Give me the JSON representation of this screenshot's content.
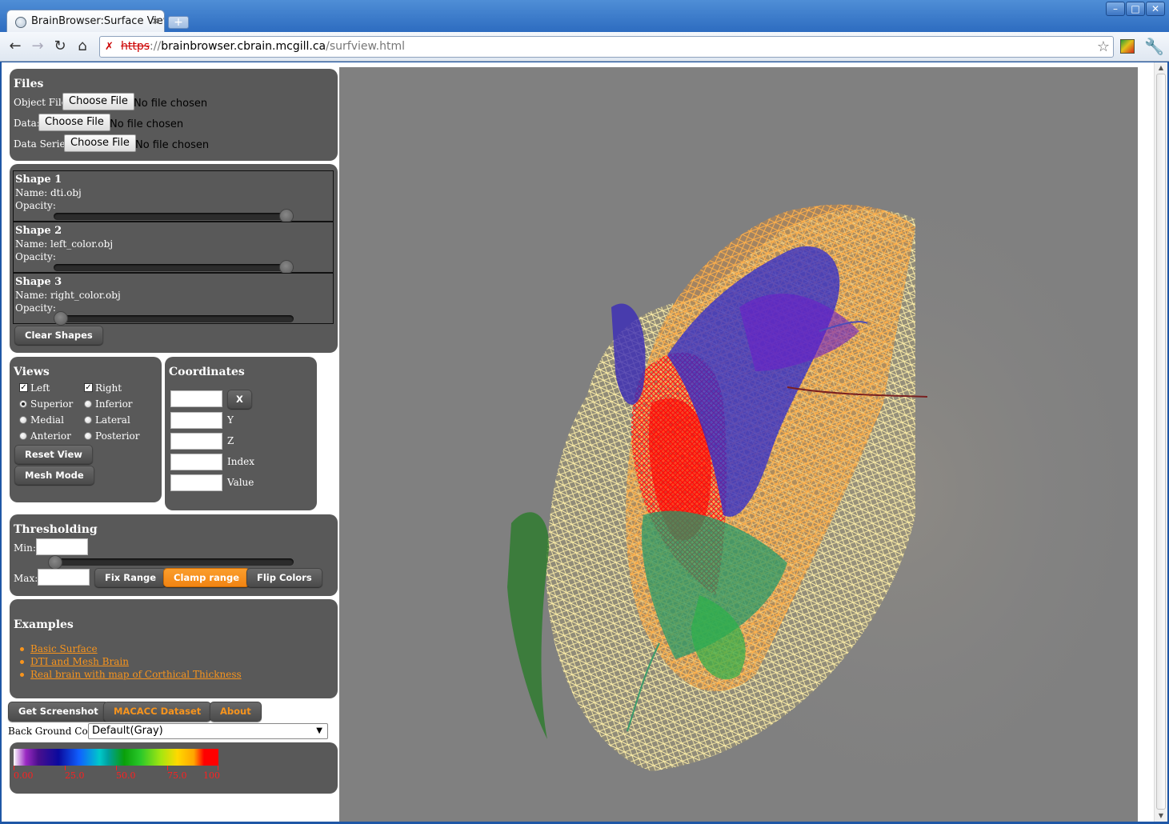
{
  "browser": {
    "tab_title": "BrainBrowser:Surface View",
    "tab_close": "×",
    "new_tab": "+",
    "url_scheme": "https",
    "url_sep": "://",
    "url_host": "brainbrowser.cbrain.mcgill.ca",
    "url_path": "/surfview.html",
    "star": "☆",
    "back": "←",
    "forward": "→",
    "reload": "↻",
    "home": "⌂",
    "wrench": "🔧",
    "win_min": "–",
    "win_max": "□",
    "win_close": "✕",
    "insecure_icon": "✗"
  },
  "files": {
    "heading": "Files",
    "choose_label": "Choose File",
    "no_file": "No file chosen",
    "rows": [
      {
        "label": "Object File:"
      },
      {
        "label": "Data:"
      },
      {
        "label": "Data Series:"
      }
    ]
  },
  "shapes": {
    "items": [
      {
        "title": "Shape 1",
        "name": "Name: dti.obj",
        "opacity_label": "Opacity:",
        "opacity": 1.0
      },
      {
        "title": "Shape 2",
        "name": "Name: left_color.obj",
        "opacity_label": "Opacity:",
        "opacity": 1.0
      },
      {
        "title": "Shape 3",
        "name": "Name: right_color.obj",
        "opacity_label": "Opacity:",
        "opacity": 0.0
      }
    ],
    "clear_label": "Clear Shapes"
  },
  "views": {
    "heading": "Views",
    "left": "Left",
    "right": "Right",
    "left_checked": true,
    "right_checked": true,
    "check_mark": "✓",
    "options": [
      "Superior",
      "Inferior",
      "Medial",
      "Lateral",
      "Anterior",
      "Posterior"
    ],
    "selected": "Superior",
    "reset_label": "Reset View",
    "mesh_label": "Mesh Mode"
  },
  "coordinates": {
    "heading": "Coordinates",
    "x_button": "X",
    "labels": [
      "Y",
      "Z",
      "Index",
      "Value"
    ]
  },
  "thresholding": {
    "heading": "Thresholding",
    "min_label": "Min:",
    "max_label": "Max:",
    "fix_label": "Fix Range",
    "clamp_label": "Clamp range",
    "flip_label": "Flip Colors"
  },
  "examples": {
    "heading": "Examples",
    "links": [
      "Basic Surface",
      "DTI and Mesh Brain",
      "Real brain with map of Corthical Thickness"
    ]
  },
  "bottom_buttons": {
    "screenshot": "Get Screenshot",
    "macacc": "MACACC Dataset",
    "about": "About"
  },
  "background": {
    "label": "Back Ground Color:",
    "selected": "Default(Gray)",
    "caret": "▼"
  },
  "colorbar": {
    "ticks": [
      "0.00",
      "25.0",
      "50.0",
      "75.0",
      "100"
    ],
    "tick_color": "#ff2020"
  },
  "colors": {
    "panel_bg": "#595959",
    "canvas_bg": "#808080",
    "accent_orange": "#f7941d"
  },
  "scrollbar": {
    "up": "▲",
    "down": "▼"
  }
}
